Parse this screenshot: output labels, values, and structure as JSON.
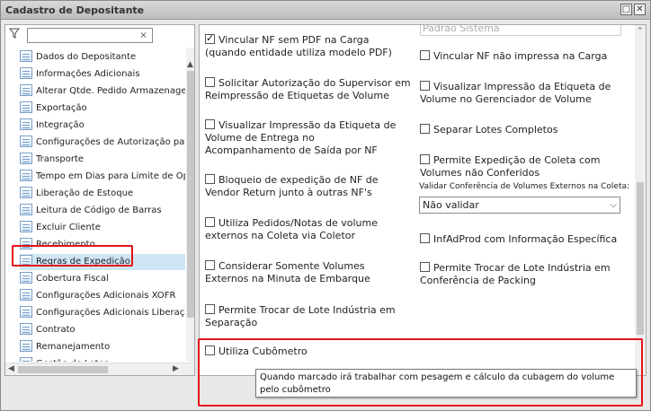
{
  "window": {
    "title": "Cadastro de Depositante",
    "restore_symbol": "□",
    "close_symbol": "✕"
  },
  "left_panel": {
    "filter_value": "",
    "clear_symbol": "×",
    "items": [
      "Dados do Depositante",
      "Informações Adicionais",
      "Alterar Qtde. Pedido Armazenagem",
      "Exportação",
      "Integração",
      "Configurações de Autorização para B",
      "Transporte",
      "Tempo em Dias para Limite de Operaç",
      "Liberação de Estoque",
      "Leitura de Código de Barras",
      "Excluir Cliente",
      "Recebimento",
      "Regras de Expedição",
      "Cobertura Fiscal",
      "Configurações Adicionais XOFR",
      "Configurações Adicionais Liberação N",
      "Contrato",
      "Remanejamento",
      "Gestão de Lotes"
    ],
    "selected_index": 12
  },
  "right_panel": {
    "top_faded_select": "Padrão Sistema",
    "left_options": [
      {
        "label": "Vincular NF sem PDF na Carga\n(quando entidade utiliza modelo PDF)",
        "checked": true
      },
      {
        "label": "Solicitar Autorização do Supervisor em\nReimpressão de Etiquetas de Volume",
        "checked": false
      },
      {
        "label": "Visualizar Impressão da Etiqueta de\nVolume de Entrega no\nAcompanhamento de Saída por NF",
        "checked": false
      },
      {
        "label": "Bloqueio de expedição de NF de\nVendor Return junto à outras NF's",
        "checked": false
      },
      {
        "label": "Utiliza Pedidos/Notas de volume\nexternos na Coleta via Coletor",
        "checked": false
      },
      {
        "label": "Considerar Somente Volumes\nExternos na Minuta de Embarque",
        "checked": false
      },
      {
        "label": "Permite Trocar de Lote Indústria em\nSeparação",
        "checked": false
      },
      {
        "label": "Utiliza Cubômetro",
        "checked": false
      }
    ],
    "right_options": [
      {
        "label": "Vincular NF não impressa na Carga",
        "checked": false
      },
      {
        "label": "Visualizar Impressão da Etiqueta de\nVolume no Gerenciador de Volume",
        "checked": false
      },
      {
        "label": "Separar Lotes Completos",
        "checked": false
      },
      {
        "label": "Permite Expedição de Coleta com\nVolumes não Conferidos",
        "checked": false
      },
      {
        "label": "InfAdProd com Informação Específica",
        "checked": false
      },
      {
        "label": "Permite Trocar de Lote Indústria em\nConferência de Packing",
        "checked": false
      }
    ],
    "validate_label": "Validar Conferência de Volumes Externos na Coleta:",
    "validate_value": "Não validar"
  },
  "tooltip": "Quando marcado irá trabalhar com pesagem e cálculo da cubagem do volume pelo cubômetro",
  "colors": {
    "highlight": "#e4141b",
    "selection": "#cfe6f5"
  }
}
